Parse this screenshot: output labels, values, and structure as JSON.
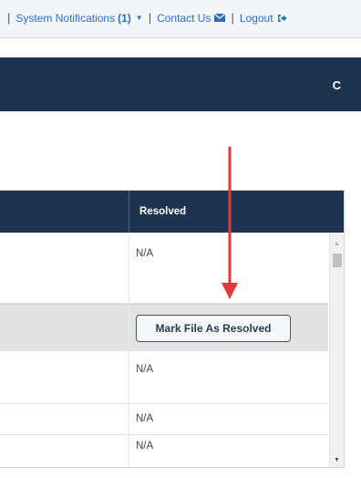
{
  "topbar": {
    "separator": "|",
    "notifications_label": "System Notifications",
    "notifications_count": "(1)",
    "caret_glyph": "▼",
    "contact_label": "Contact Us",
    "logout_label": "Logout"
  },
  "header": {
    "refresh_glyph": "C"
  },
  "grid": {
    "resolved_header": "Resolved",
    "rows": [
      {
        "resolved": "N/A"
      },
      {
        "resolved_button": "Mark File As Resolved"
      },
      {
        "resolved": "N/A"
      },
      {
        "resolved": "N/A"
      },
      {
        "resolved": "N/A"
      }
    ]
  },
  "scrollbar": {
    "up_glyph": "▲",
    "down_glyph": "▼"
  },
  "colors": {
    "navy": "#1e3350",
    "link_blue": "#2a6fc2",
    "annotation_red": "#e03a3a"
  }
}
